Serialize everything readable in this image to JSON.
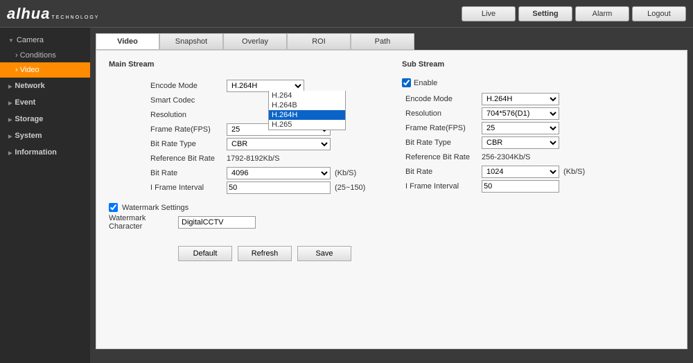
{
  "header": {
    "logo": "alhua",
    "logo_sub": "TECHNOLOGY",
    "tabs": [
      "Live",
      "Setting",
      "Alarm",
      "Logout"
    ]
  },
  "sidebar": {
    "camera": "Camera",
    "conditions": "Conditions",
    "video": "Video",
    "items": [
      "Network",
      "Event",
      "Storage",
      "System",
      "Information"
    ]
  },
  "tabs": [
    "Video",
    "Snapshot",
    "Overlay",
    "ROI",
    "Path"
  ],
  "main_stream": {
    "title": "Main Stream",
    "encode_mode": {
      "label": "Encode Mode",
      "value": "H.264H",
      "options": [
        "H.264",
        "H.264B",
        "H.264H",
        "H.265"
      ]
    },
    "smart_codec": {
      "label": "Smart Codec"
    },
    "resolution": {
      "label": "Resolution"
    },
    "fps": {
      "label": "Frame Rate(FPS)",
      "value": "25"
    },
    "brt": {
      "label": "Bit Rate Type",
      "value": "CBR"
    },
    "ref": {
      "label": "Reference Bit Rate",
      "value": "1792-8192Kb/S"
    },
    "br": {
      "label": "Bit Rate",
      "value": "4096",
      "unit": "(Kb/S)"
    },
    "ifi": {
      "label": "I Frame Interval",
      "value": "50",
      "unit": "(25~150)"
    },
    "wm": {
      "label": "Watermark Settings"
    },
    "wmc": {
      "label": "Watermark Character",
      "value": "DigitalCCTV"
    }
  },
  "sub_stream": {
    "title": "Sub Stream",
    "enable": "Enable",
    "encode_mode": {
      "label": "Encode Mode",
      "value": "H.264H"
    },
    "resolution": {
      "label": "Resolution",
      "value": "704*576(D1)"
    },
    "fps": {
      "label": "Frame Rate(FPS)",
      "value": "25"
    },
    "brt": {
      "label": "Bit Rate Type",
      "value": "CBR"
    },
    "ref": {
      "label": "Reference Bit Rate",
      "value": "256-2304Kb/S"
    },
    "br": {
      "label": "Bit Rate",
      "value": "1024",
      "unit": "(Kb/S)"
    },
    "ifi": {
      "label": "I Frame Interval",
      "value": "50"
    }
  },
  "buttons": {
    "default": "Default",
    "refresh": "Refresh",
    "save": "Save"
  }
}
